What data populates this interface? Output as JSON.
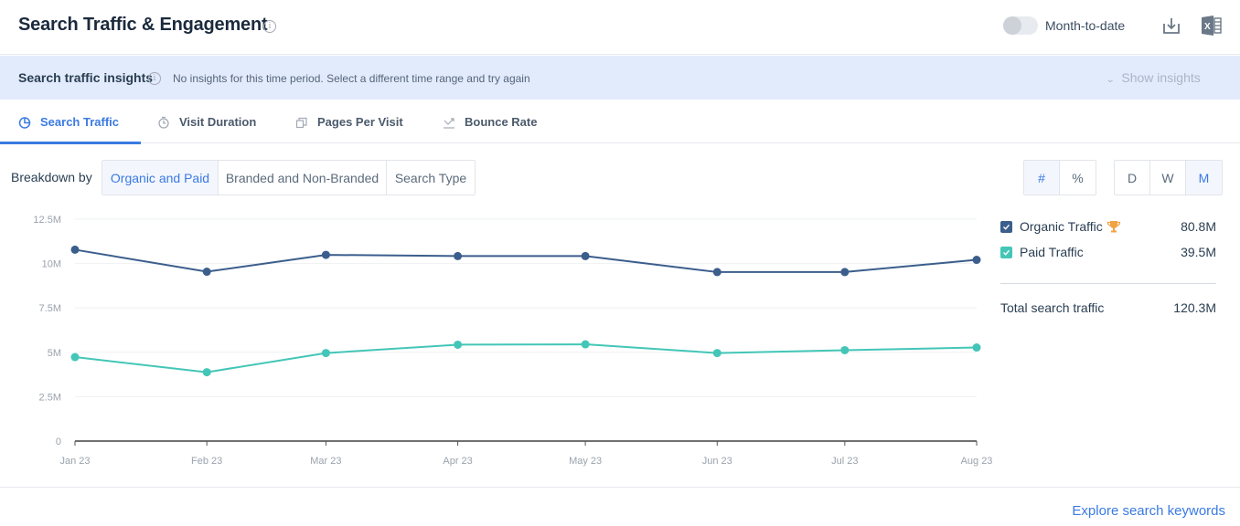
{
  "header": {
    "title": "Search Traffic & Engagement",
    "info_glyph": "i",
    "toggle_label": "Month-to-date",
    "toggle_on": false,
    "download_icon": "download-icon",
    "excel_icon": "excel-icon"
  },
  "insights": {
    "title": "Search traffic insights",
    "info_glyph": "i",
    "message": "No insights for this time period. Select a different time range and try again",
    "show_label": "Show insights",
    "chevron": "⌄"
  },
  "tabs": [
    {
      "label": "Search Traffic",
      "icon": "pie-chart-icon",
      "active": true
    },
    {
      "label": "Visit Duration",
      "icon": "stopwatch-icon",
      "active": false
    },
    {
      "label": "Pages Per Visit",
      "icon": "pages-icon",
      "active": false
    },
    {
      "label": "Bounce Rate",
      "icon": "bounce-icon",
      "active": false
    }
  ],
  "breakdown": {
    "label": "Breakdown by",
    "options": [
      {
        "label": "Organic and Paid",
        "active": true
      },
      {
        "label": "Branded and Non-Branded",
        "active": false
      },
      {
        "label": "Search Type",
        "active": false
      }
    ]
  },
  "metric_toggle": {
    "options": [
      {
        "label": "#",
        "active": true
      },
      {
        "label": "%",
        "active": false
      }
    ]
  },
  "granularity": {
    "options": [
      {
        "label": "D",
        "active": false
      },
      {
        "label": "W",
        "active": false
      },
      {
        "label": "M",
        "active": true
      }
    ]
  },
  "legend": {
    "items": [
      {
        "name": "Organic Traffic",
        "value": "80.8M",
        "color": "#3b5e8c",
        "checked": true,
        "trophy": true
      },
      {
        "name": "Paid Traffic",
        "value": "39.5M",
        "color": "#43c6b7",
        "checked": true,
        "trophy": false
      }
    ],
    "total_label": "Total search traffic",
    "total_value": "120.3M"
  },
  "colors": {
    "accent": "#3a7ae3",
    "organic": "#3b5e8c",
    "paid": "#43c6b7",
    "trophy": "#f0a342"
  },
  "chart_data": {
    "type": "line",
    "title": "",
    "xlabel": "",
    "ylabel": "",
    "categories": [
      "Jan 23",
      "Feb 23",
      "Mar 23",
      "Apr 23",
      "May 23",
      "Jun 23",
      "Jul 23",
      "Aug 23"
    ],
    "x_days": [
      0,
      31,
      59,
      90,
      120,
      151,
      181,
      212
    ],
    "series": [
      {
        "name": "Organic Traffic",
        "color": "#3b5e8c",
        "values": [
          10.78,
          9.54,
          10.49,
          10.42,
          10.42,
          9.52,
          9.52,
          10.21
        ]
      },
      {
        "name": "Paid Traffic",
        "color": "#43c6b7",
        "values": [
          4.73,
          3.88,
          4.96,
          5.43,
          5.45,
          4.96,
          5.12,
          5.27
        ]
      }
    ],
    "unit": "M",
    "ylim": [
      0,
      12.5
    ],
    "yticks": [
      0,
      2.5,
      5,
      7.5,
      10,
      12.5
    ],
    "ytick_labels": [
      "0",
      "2.5M",
      "5M",
      "7.5M",
      "10M",
      "12.5M"
    ],
    "grid": true,
    "legend_position": "right"
  },
  "footer": {
    "link_label": "Explore search keywords"
  }
}
